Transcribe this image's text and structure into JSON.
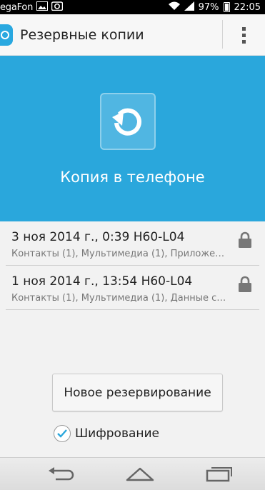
{
  "status_bar": {
    "carrier": "egaFon",
    "battery": "97%",
    "time": "22:05",
    "icons": [
      "image-icon",
      "camera-icon",
      "wifi-icon",
      "signal-icon",
      "battery-icon"
    ]
  },
  "action_bar": {
    "title": "Резервные копии",
    "app_icon": "backup-app-icon",
    "menu_icon": "overflow-menu-icon"
  },
  "hero": {
    "title": "Копия в телефоне",
    "icon": "restore-icon"
  },
  "backups": [
    {
      "title": "3 ноя 2014 г., 0:39 H60-L04",
      "details": "Контакты (1), Мультимедиа (1), Приложе…",
      "icon": "lock-icon"
    },
    {
      "title": "1 ноя 2014 г., 13:54 H60-L04",
      "details": "Контакты (1), Мультимедиа (1), Данные с…",
      "icon": "lock-icon"
    }
  ],
  "new_backup_button": "Новое резервирование",
  "encryption": {
    "label": "Шифрование",
    "checked": true
  },
  "nav": {
    "back_icon": "back-icon",
    "home_icon": "home-icon",
    "recents_icon": "recents-icon"
  },
  "colors": {
    "accent": "#2aa7dc",
    "text_primary": "#222222",
    "text_secondary": "#777777"
  }
}
